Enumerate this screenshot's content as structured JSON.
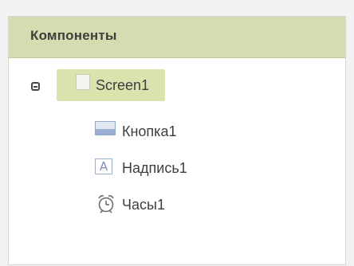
{
  "panel": {
    "title": "Компоненты"
  },
  "tree": {
    "root": {
      "label": "Screen1",
      "icon": "screen-icon",
      "expanded": true
    },
    "children": [
      {
        "label": "Кнопка1",
        "icon": "button-component-icon"
      },
      {
        "label": "Надпись1",
        "icon": "label-component-icon",
        "icon_text": "A"
      },
      {
        "label": "Часы1",
        "icon": "clock-component-icon"
      }
    ]
  },
  "colors": {
    "header_bg": "#d3ddb0",
    "selected_bg": "#d8e3ae",
    "text": "#3e3e3e",
    "icon_blue": "#9aaed3"
  }
}
